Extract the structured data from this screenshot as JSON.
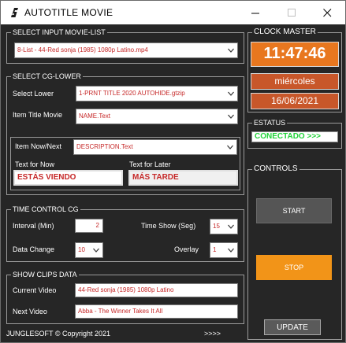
{
  "window": {
    "title": "AUTOTITLE MOVIE"
  },
  "input_movie": {
    "section": "SELECT INPUT MOVIE-LIST",
    "selected": "8-List - 44-Red sonja (1985) 1080p Latino.mp4"
  },
  "cg_lower": {
    "section": "SELECT CG-LOWER",
    "select_lower_label": "Select Lower",
    "select_lower_value": "1-PRNT TITLE 2020 AUTOHIDE.gtzip",
    "item_title_label": "Item Title Movie",
    "item_title_value": "NAME.Text",
    "item_now_next_label": "Item Now/Next",
    "item_now_next_value": "DESCRIPTION.Text",
    "text_now_label": "Text for Now",
    "text_now_value": "ESTÁS VIENDO",
    "text_later_label": "Text for Later",
    "text_later_value": "MÁS TARDE"
  },
  "time_control": {
    "section": "TIME CONTROL CG",
    "interval_label": "Interval (Min)",
    "interval_value": "2",
    "time_show_label": "Time Show (Seg)",
    "time_show_value": "15",
    "data_change_label": "Data Change",
    "data_change_value": "10",
    "overlay_label": "Overlay",
    "overlay_value": "1"
  },
  "clips": {
    "section": "SHOW CLIPS DATA",
    "current_label": "Current Video",
    "current_value": "44-Red sonja (1985) 1080p Latino",
    "next_label": "Next Video",
    "next_value": "Abba - The Winner Takes It All"
  },
  "clock": {
    "section": "CLOCK MASTER",
    "time": "11:47:46",
    "weekday": "miércoles",
    "date": "16/06/2021"
  },
  "status": {
    "section": "ESTATUS",
    "text": "CONECTADO >>>"
  },
  "controls": {
    "section": "CONTROLS",
    "start": "START",
    "stop": "STOP",
    "update": "UPDATE"
  },
  "footer": {
    "copyright": "JUNGLESOFT © Copyright 2021",
    "arrows": ">>>>"
  },
  "colors": {
    "background": "#262626",
    "accent_orange": "#f29418",
    "clock_orange": "#e8771f",
    "date_rust": "#c8572a",
    "status_green": "#22d33a",
    "value_red": "#c62828"
  }
}
